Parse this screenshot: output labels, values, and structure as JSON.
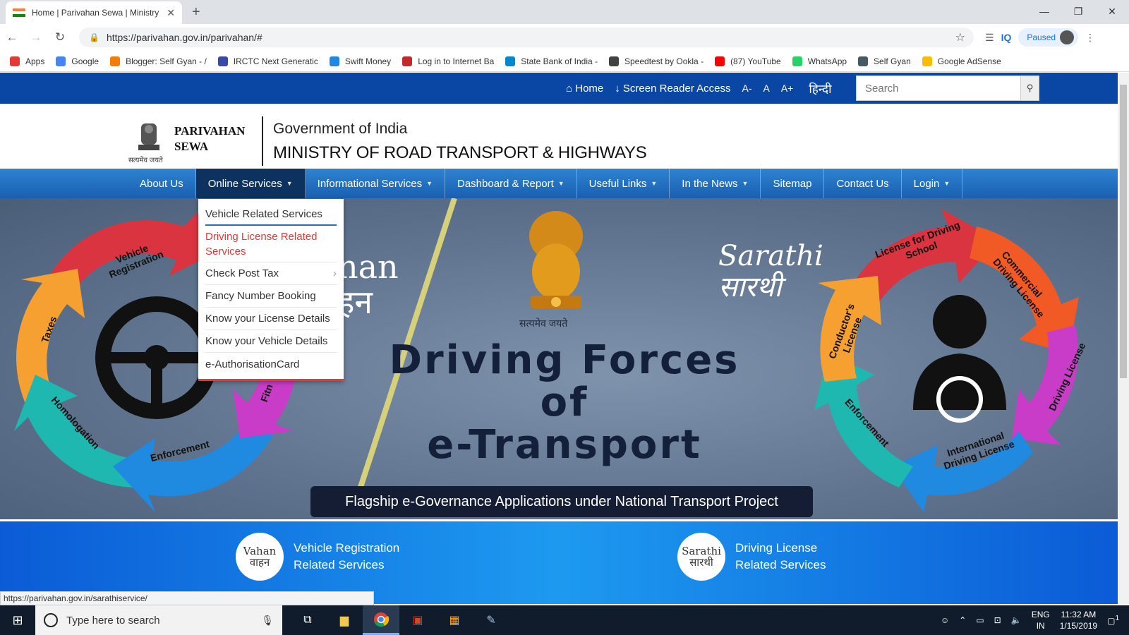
{
  "browser": {
    "tab_title": "Home | Parivahan Sewa | Ministry",
    "tab_close": "✕",
    "new_tab": "+",
    "url": "https://parivahan.gov.in/parivahan/#",
    "iq": "IQ",
    "profile_status": "Paused",
    "bookmarks": [
      {
        "label": "Apps",
        "color": "#e53935"
      },
      {
        "label": "Google",
        "color": "#4285f4"
      },
      {
        "label": "Blogger: Self Gyan - /",
        "color": "#f57c00"
      },
      {
        "label": "IRCTC Next Generatic",
        "color": "#3949ab"
      },
      {
        "label": "Swift Money",
        "color": "#1e88e5"
      },
      {
        "label": "Log in to Internet Ba",
        "color": "#c62828"
      },
      {
        "label": "State Bank of India -",
        "color": "#0288d1"
      },
      {
        "label": "Speedtest by Ookla -",
        "color": "#424242"
      },
      {
        "label": "(87) YouTube",
        "color": "#ff0000"
      },
      {
        "label": "WhatsApp",
        "color": "#25d366"
      },
      {
        "label": "Self Gyan",
        "color": "#455a64"
      },
      {
        "label": "Google AdSense",
        "color": "#fbbc05"
      }
    ],
    "status_url": "https://parivahan.gov.in/sarathiservice/"
  },
  "topbar": {
    "home": "Home",
    "screen_reader": "Screen Reader Access",
    "font_small": "A-",
    "font_normal": "A",
    "font_large": "A+",
    "hindi": "हिन्दी",
    "search_placeholder": "Search"
  },
  "header": {
    "brand_line1": "PARIVAHAN",
    "brand_line2": "SEWA",
    "emblem_caption": "सत्यमेव जयते",
    "gov": "Government of India",
    "ministry": "MINISTRY OF ROAD TRANSPORT & HIGHWAYS"
  },
  "nav": [
    {
      "label": "About Us"
    },
    {
      "label": "Online Services",
      "caret": "▼"
    },
    {
      "label": "Informational Services",
      "caret": "▼"
    },
    {
      "label": "Dashboard & Report",
      "caret": "▼"
    },
    {
      "label": "Useful Links",
      "caret": "▼"
    },
    {
      "label": "In the News",
      "caret": "▼"
    },
    {
      "label": "Sitemap"
    },
    {
      "label": "Contact Us"
    },
    {
      "label": "Login",
      "caret": "▼"
    }
  ],
  "dropdown": [
    {
      "label": "Vehicle Related Services"
    },
    {
      "label": "Driving License Related Services"
    },
    {
      "label": "Check Post Tax",
      "submenu": "›"
    },
    {
      "label": "Fancy Number Booking"
    },
    {
      "label": "Know your License Details"
    },
    {
      "label": "Know your Vehicle Details"
    },
    {
      "label": "e-AuthorisationCard"
    }
  ],
  "hero": {
    "title_line1": "Driving Forces",
    "title_line2": "of",
    "title_line3": "e-Transport",
    "emblem_caption": "सत्यमेव जयते",
    "vahan_logo": "nan\nहन",
    "sarathi_logo": "Sarathi\nसारथी",
    "tagline": "Flagship e-Governance Applications under National Transport Project",
    "left_wheel": [
      "Vehicle Registration",
      "Taxes",
      "Homologation",
      "Enforcement",
      "Fitn"
    ],
    "right_wheel": [
      "License for Driving School",
      "Commercial Driving License",
      "Driving License",
      "International Driving License",
      "Enforcement",
      "Conductor's License"
    ]
  },
  "services": [
    {
      "logo": "Vahan\nवाहन",
      "line1": "Vehicle Registration",
      "line2": "Related Services"
    },
    {
      "logo": "Sarathi\nसारथी",
      "line1": "Driving License",
      "line2": "Related Services"
    }
  ],
  "taskbar": {
    "search_placeholder": "Type here to search",
    "lang1": "ENG",
    "lang2": "IN",
    "time": "11:32 AM",
    "date": "1/15/2019",
    "notifications": "1"
  }
}
